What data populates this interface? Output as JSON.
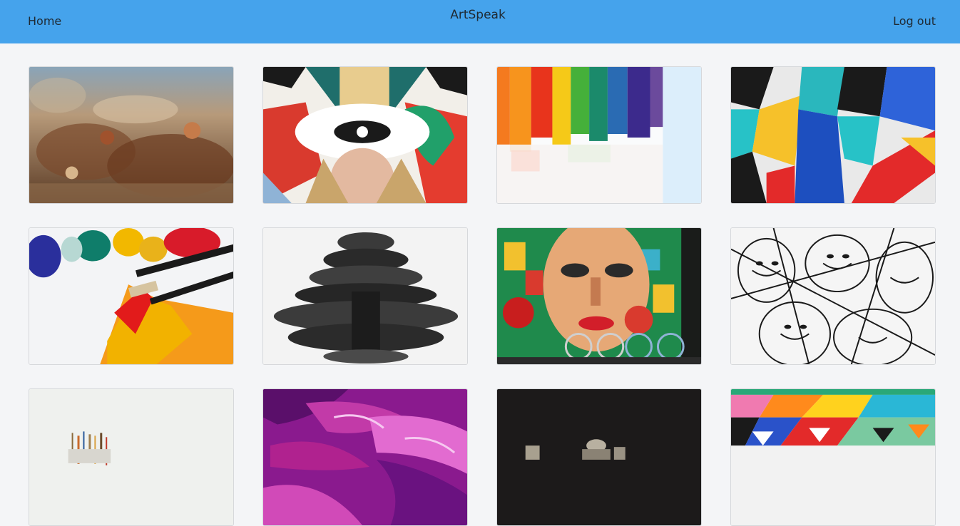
{
  "navbar": {
    "home_label": "Home",
    "brand": "ArtSpeak",
    "logout_label": "Log out",
    "background": "#45a3ec"
  },
  "gallery": {
    "images": [
      {
        "subject": "baroque-ceiling-fresco"
      },
      {
        "subject": "collage-eye-face"
      },
      {
        "subject": "rainbow-paint-strokes"
      },
      {
        "subject": "geometric-colorful-mural"
      },
      {
        "subject": "paint-tubes-brushes"
      },
      {
        "subject": "black-white-ink-figure"
      },
      {
        "subject": "graffiti-woman-face-bicycles"
      },
      {
        "subject": "line-drawing-faces"
      },
      {
        "subject": "paintbrushes-in-cup"
      },
      {
        "subject": "purple-fluid-paint"
      },
      {
        "subject": "dark-sculpture-scene"
      },
      {
        "subject": "geometric-triangles-mural"
      }
    ]
  }
}
